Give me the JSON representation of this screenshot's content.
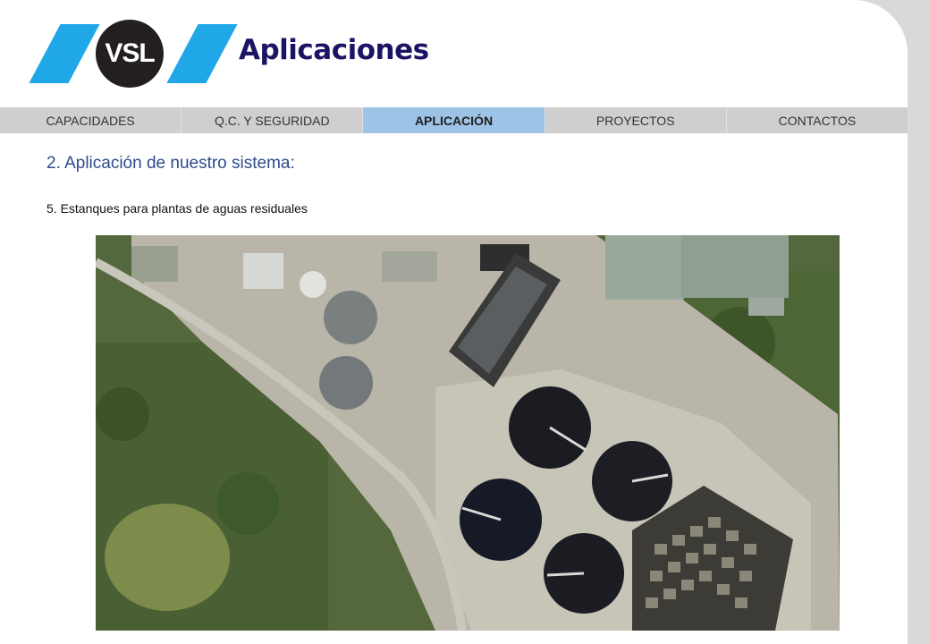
{
  "header": {
    "logo_text": "VSL",
    "title": "Aplicaciones",
    "brand_color": "#1fa7e8"
  },
  "nav": {
    "items": [
      {
        "label": "CAPACIDADES",
        "active": false
      },
      {
        "label": "Q.C. Y SEGURIDAD",
        "active": false
      },
      {
        "label": "APLICACIÓN",
        "active": true
      },
      {
        "label": "PROYECTOS",
        "active": false
      },
      {
        "label": "CONTACTOS",
        "active": false
      }
    ]
  },
  "content": {
    "section_heading": "2. Aplicación de nuestro sistema:",
    "sub_heading": "5. Estanques para plantas de aguas residuales",
    "photo_icon": "aerial-photo-wastewater-plant"
  }
}
